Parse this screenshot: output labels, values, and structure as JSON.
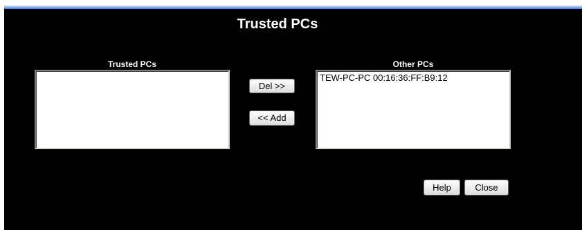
{
  "dialog": {
    "title": "Trusted PCs"
  },
  "trusted_list": {
    "label": "Trusted PCs",
    "items": []
  },
  "other_list": {
    "label": "Other PCs",
    "items": [
      {
        "text": "TEW-PC-PC 00:16:36:FF:B9:12"
      }
    ]
  },
  "buttons": {
    "del": "Del >>",
    "add": "<< Add",
    "help": "Help",
    "close": "Close"
  }
}
